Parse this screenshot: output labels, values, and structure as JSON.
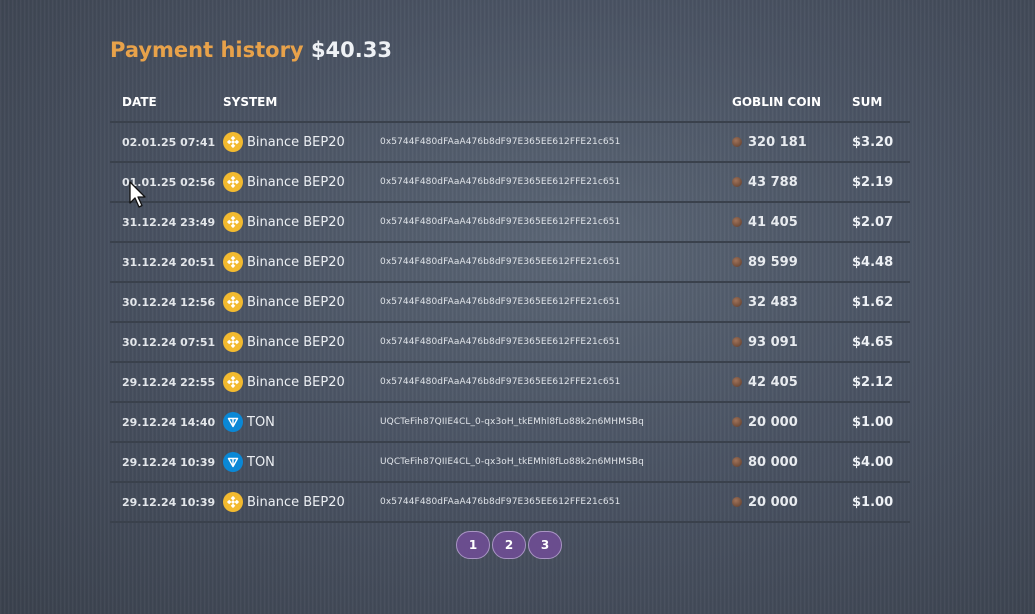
{
  "header": {
    "title": "Payment history",
    "total": "$40.33"
  },
  "table": {
    "columns": {
      "date": "DATE",
      "system": "SYSTEM",
      "address": "",
      "coin": "GOBLIN COIN",
      "sum": "SUM"
    },
    "rows": [
      {
        "date": "02.01.25 07:41",
        "system": "Binance BEP20",
        "icon": "binance-icon",
        "address": "0x5744F480dFAaA476b8dF97E365EE612FFE21c651",
        "coin": "320 181",
        "sum": "$3.20"
      },
      {
        "date": "01.01.25 02:56",
        "system": "Binance BEP20",
        "icon": "binance-icon",
        "address": "0x5744F480dFAaA476b8dF97E365EE612FFE21c651",
        "coin": "43 788",
        "sum": "$2.19"
      },
      {
        "date": "31.12.24 23:49",
        "system": "Binance BEP20",
        "icon": "binance-icon",
        "address": "0x5744F480dFAaA476b8dF97E365EE612FFE21c651",
        "coin": "41 405",
        "sum": "$2.07"
      },
      {
        "date": "31.12.24 20:51",
        "system": "Binance BEP20",
        "icon": "binance-icon",
        "address": "0x5744F480dFAaA476b8dF97E365EE612FFE21c651",
        "coin": "89 599",
        "sum": "$4.48"
      },
      {
        "date": "30.12.24 12:56",
        "system": "Binance BEP20",
        "icon": "binance-icon",
        "address": "0x5744F480dFAaA476b8dF97E365EE612FFE21c651",
        "coin": "32 483",
        "sum": "$1.62"
      },
      {
        "date": "30.12.24 07:51",
        "system": "Binance BEP20",
        "icon": "binance-icon",
        "address": "0x5744F480dFAaA476b8dF97E365EE612FFE21c651",
        "coin": "93 091",
        "sum": "$4.65"
      },
      {
        "date": "29.12.24 22:55",
        "system": "Binance BEP20",
        "icon": "binance-icon",
        "address": "0x5744F480dFAaA476b8dF97E365EE612FFE21c651",
        "coin": "42 405",
        "sum": "$2.12"
      },
      {
        "date": "29.12.24 14:40",
        "system": "TON",
        "icon": "ton-icon",
        "address": "UQCTeFih87QIIE4CL_0-qx3oH_tkEMhl8fLo88k2n6MHMSBq",
        "coin": "20 000",
        "sum": "$1.00"
      },
      {
        "date": "29.12.24 10:39",
        "system": "TON",
        "icon": "ton-icon",
        "address": "UQCTeFih87QIIE4CL_0-qx3oH_tkEMhl8fLo88k2n6MHMSBq",
        "coin": "80 000",
        "sum": "$4.00"
      },
      {
        "date": "29.12.24 10:39",
        "system": "Binance BEP20",
        "icon": "binance-icon",
        "address": "0x5744F480dFAaA476b8dF97E365EE612FFE21c651",
        "coin": "20 000",
        "sum": "$1.00"
      }
    ]
  },
  "pagination": {
    "pages": [
      "1",
      "2",
      "3"
    ]
  },
  "colors": {
    "accent": "#e8a24a",
    "binance": "#f3ba2f",
    "ton": "#0a88d6",
    "page_button": "#6a4d8e"
  }
}
